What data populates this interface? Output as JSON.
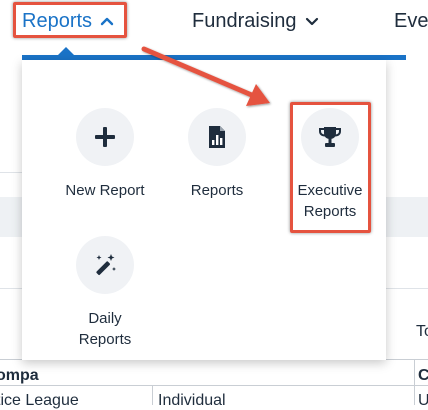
{
  "nav": {
    "items": [
      {
        "label": "Reports",
        "active": true
      },
      {
        "label": "Fundraising",
        "active": false
      },
      {
        "label": "Ever",
        "active": false
      }
    ],
    "accent_color": "#1a73c7"
  },
  "menu": {
    "tiles": [
      {
        "label": "New Report",
        "icon": "plus-icon"
      },
      {
        "label": "Reports",
        "icon": "report-chart-icon"
      },
      {
        "label": "Executive\nReports",
        "icon": "trophy-icon"
      },
      {
        "label": "Daily\nReports",
        "icon": "magic-wand-icon"
      }
    ]
  },
  "background": {
    "column_header_fragment": "To",
    "table_header_left": "ompa",
    "table_header_right": "C",
    "row_cells": [
      "tice League",
      "Individual",
      "U"
    ]
  },
  "annotation": {
    "highlight_color": "#e5533f"
  }
}
